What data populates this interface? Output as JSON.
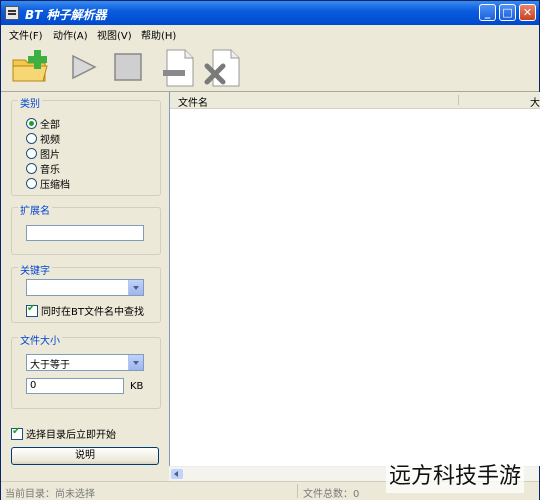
{
  "window": {
    "title": "BT 种子解析器",
    "controls": {
      "minimize": "_",
      "maximize": "□",
      "close": "✕"
    }
  },
  "menu": {
    "items": [
      {
        "label": "文件(F)"
      },
      {
        "label": "动作(A)"
      },
      {
        "label": "视图(V)"
      },
      {
        "label": "帮助(H)"
      }
    ]
  },
  "toolbar": {
    "icons": [
      "open-folder-add-icon",
      "play-icon",
      "stop-icon",
      "remove-file-icon",
      "delete-file-icon"
    ]
  },
  "category": {
    "label": "类别",
    "options": [
      {
        "label": "全部",
        "selected": true
      },
      {
        "label": "视频",
        "selected": false
      },
      {
        "label": "图片",
        "selected": false
      },
      {
        "label": "音乐",
        "selected": false
      },
      {
        "label": "压缩档",
        "selected": false
      }
    ]
  },
  "extension": {
    "label": "扩展名",
    "value": ""
  },
  "keyword": {
    "label": "关键字",
    "value": "",
    "checkbox_label": "同时在BT文件名中查找",
    "checked": true
  },
  "filesize": {
    "label": "文件大小",
    "comparison": "大于等于",
    "value": "0",
    "unit": "KB"
  },
  "start_immediately": {
    "label": "选择目录后立即开始",
    "checked": true
  },
  "help_button": "说明",
  "list": {
    "columns": [
      "文件名",
      "大"
    ]
  },
  "status": {
    "current_dir": "当前目录：尚未选择",
    "file_count": "文件总数：0"
  },
  "watermark": "远方科技手游",
  "colors": {
    "title_bar": "#0048cc",
    "group_label": "#0046d5",
    "window_bg": "#ece9d8"
  }
}
